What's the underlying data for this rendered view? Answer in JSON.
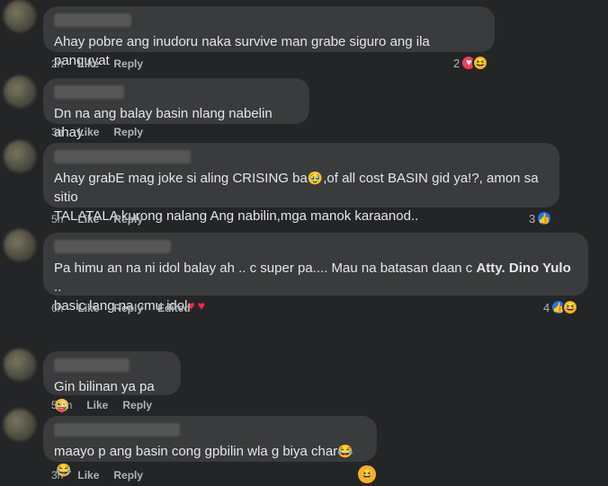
{
  "comments": [
    {
      "text": "Ahay pobre ang inudoru naka survive man grabe siguro ang ila panguyat",
      "time": "2h",
      "like": "Like",
      "reply": "Reply",
      "reaction_count": "2"
    },
    {
      "text": "Dn na ang balay basin nlang nabelin ahay",
      "time": "3h",
      "like": "Like",
      "reply": "Reply"
    },
    {
      "text_a": "Ahay grabE mag joke si aling CRISING ba",
      "text_b": ",of all cost BASIN gid ya!?, amon sa sitio",
      "text_c": "TALATALA kurong nalang Ang nabilin,mga manok karaanod..",
      "time": "5h",
      "like": "Like",
      "reply": "Reply",
      "reaction_count": "3"
    },
    {
      "text_a": "Pa himu an na ni idol balay ah .. c super pa.... Mau na batasan daan c ",
      "text_bold": "Atty. Dino Yulo",
      "text_b": " ..",
      "text_c": "basic lang na cmu idol",
      "time": "6h",
      "like": "Like",
      "reply": "Reply",
      "edited": "Edited",
      "reaction_count": "4"
    },
    {
      "text": "Gin bilinan ya pa",
      "time": "52m",
      "like": "Like",
      "reply": "Reply"
    },
    {
      "text": "maayo p ang basin cong gpbilin wla g biya char",
      "time": "3h",
      "like": "Like",
      "reply": "Reply"
    }
  ],
  "icons": {
    "heart": "heart-icon",
    "like": "thumbs-up-icon",
    "haha": "laughing-emoji-icon",
    "crying": "crying-emoji-icon",
    "wink": "wink-tongue-emoji-icon"
  },
  "colors": {
    "background": "#242526",
    "bubble": "#3a3b3c",
    "text": "#e4e6eb",
    "meta": "#b0b3b8",
    "like_blue": "#1877f2",
    "heart_red": "#f33e58",
    "haha_yellow": "#f7b125"
  }
}
